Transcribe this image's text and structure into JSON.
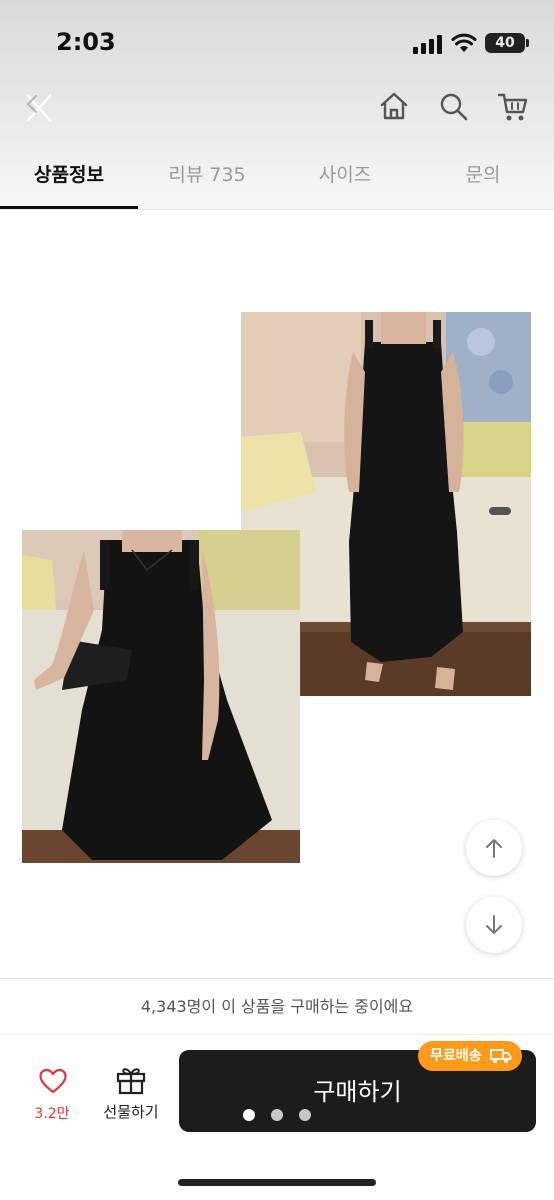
{
  "status": {
    "time": "2:03",
    "battery": "40"
  },
  "header": {
    "close_icon": "close-icon",
    "home_icon": "home-icon",
    "search_icon": "search-icon",
    "cart_icon": "cart-icon"
  },
  "tabs": [
    {
      "label": "상품정보",
      "active": true
    },
    {
      "label": "리뷰 735",
      "active": false
    },
    {
      "label": "사이즈",
      "active": false
    },
    {
      "label": "문의",
      "active": false
    }
  ],
  "content": {
    "images": [
      "product-photo-standing",
      "product-photo-sitting"
    ],
    "scroll_up_icon": "arrow-up-icon",
    "scroll_down_icon": "arrow-down-icon"
  },
  "purchase_notice": "4,343명이 이 상품을 구매하는 중이에요",
  "bottom_bar": {
    "like_count": "3.2만",
    "gift_label": "선물하기",
    "buy_label": "구매하기",
    "free_shipping_badge": "무료배송"
  },
  "colors": {
    "accent": "#ff9a1a",
    "like": "#e2383c",
    "buy_button": "#1c1c1c"
  }
}
